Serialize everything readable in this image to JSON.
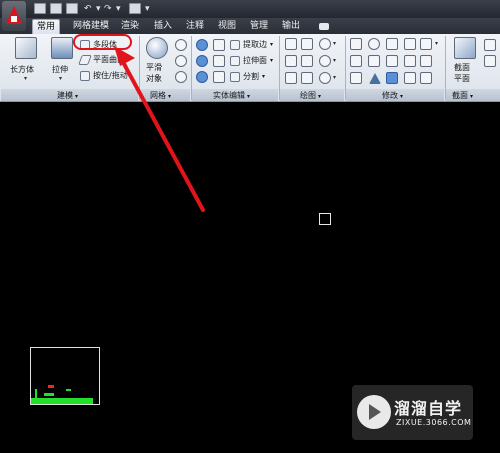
{
  "quick_access": {
    "icons": [
      "new-icon",
      "open-icon",
      "save-icon",
      "undo-icon",
      "redo-icon",
      "plot-icon"
    ]
  },
  "tabs": [
    {
      "label": "常用",
      "active": true
    },
    {
      "label": "网格建模",
      "active": false
    },
    {
      "label": "渲染",
      "active": false
    },
    {
      "label": "插入",
      "active": false
    },
    {
      "label": "注释",
      "active": false
    },
    {
      "label": "视图",
      "active": false
    },
    {
      "label": "管理",
      "active": false
    },
    {
      "label": "输出",
      "active": false
    }
  ],
  "ribbon": {
    "modeling": {
      "label": "建模",
      "box_label": "长方体",
      "extrude_label": "拉伸",
      "polysolid_label": "多段体",
      "planar_label": "平面曲面",
      "presspull_label": "按住/拖动"
    },
    "mesh": {
      "label": "网格",
      "smooth_label_1": "平滑",
      "smooth_label_2": "对象"
    },
    "solid_edit": {
      "label": "实体编辑",
      "extract_edges_label": "提取边",
      "extrude_faces_label": "拉伸面",
      "separate_label": "分割"
    },
    "draw": {
      "label": "绘图"
    },
    "modify": {
      "label": "修改"
    },
    "section": {
      "label": "截面",
      "section_plane_label_1": "截面",
      "section_plane_label_2": "平面"
    }
  },
  "colors": {
    "highlight": "#e0141a",
    "ucs_green": "#22e02a",
    "canvas": "#000000"
  },
  "watermark": {
    "title": "溜溜自学",
    "url": "ZIXUE.3066.COM"
  }
}
